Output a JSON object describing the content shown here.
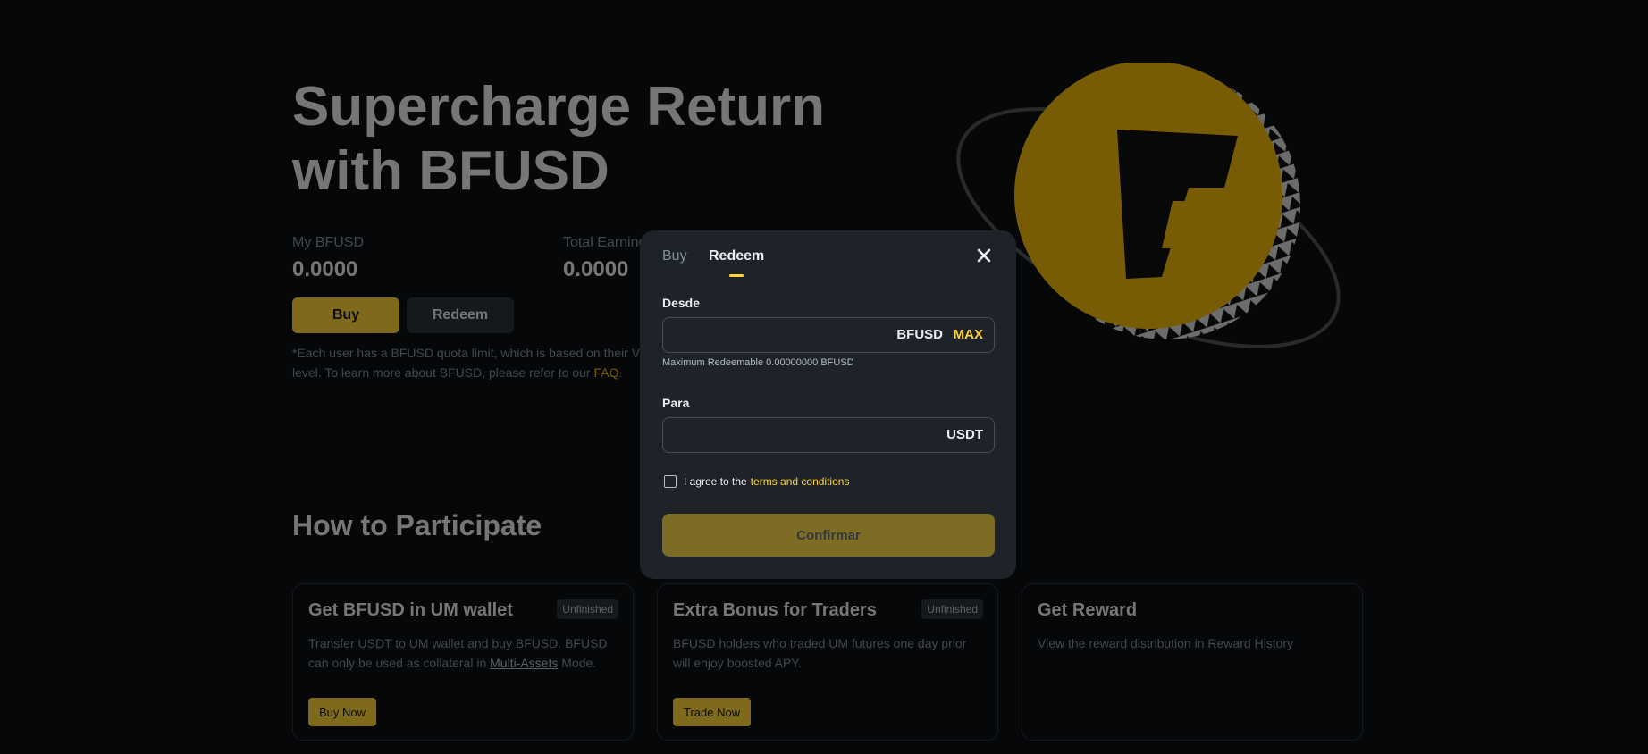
{
  "hero": {
    "title_line1": "Supercharge Return",
    "title_line2": "with BFUSD",
    "my_label": "My BFUSD",
    "my_value": "0.0000",
    "earning_label": "Total Earnings",
    "earning_value": "0.0000",
    "buy_label": "Buy",
    "redeem_label": "Redeem",
    "note_text": "*Each user has a BFUSD quota limit, which is based on their VIP level. To learn more about BFUSD, please refer to our",
    "note_link": "FAQ",
    "note_end": "."
  },
  "participate": {
    "title": "How to Participate",
    "cards": [
      {
        "title": "Get BFUSD in UM wallet",
        "badge": "Unfinished",
        "desc_a": "Transfer USDT to UM wallet and buy BFUSD. BFUSD can only be used as collateral in",
        "desc_link": "Multi-Assets",
        "desc_b": "Mode.",
        "button": "Buy Now"
      },
      {
        "title": "Extra Bonus for Traders",
        "badge": "Unfinished",
        "desc": "BFUSD holders who traded UM futures one day prior will enjoy boosted APY.",
        "button": "Trade Now"
      },
      {
        "title": "Get Reward",
        "desc": "View the reward distribution in Reward History"
      }
    ]
  },
  "modal": {
    "tab_buy": "Buy",
    "tab_redeem": "Redeem",
    "from_label": "Desde",
    "from_currency": "BFUSD",
    "max_label": "MAX",
    "hint": "Maximum Redeemable 0.00000000 BFUSD",
    "to_label": "Para",
    "to_currency": "USDT",
    "agree_text": "I agree to the",
    "terms_link": "terms and conditions",
    "confirm_label": "Confirmar"
  },
  "colors": {
    "accent": "#fcd535",
    "background": "#0b0e11",
    "modal": "#1e2329"
  }
}
